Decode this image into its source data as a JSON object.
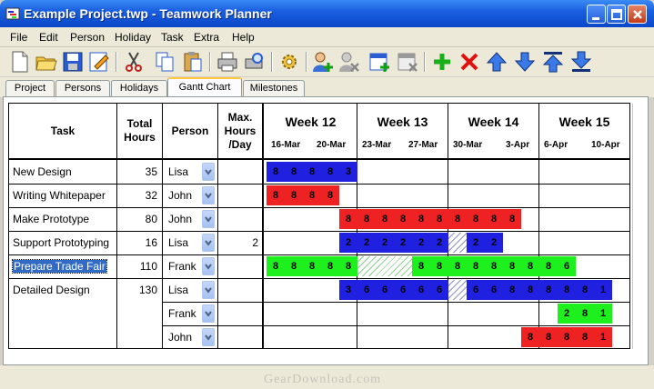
{
  "window": {
    "title": "Example Project.twp - Teamwork Planner"
  },
  "menu": [
    "File",
    "Edit",
    "Person",
    "Holiday",
    "Task",
    "Extra",
    "Help"
  ],
  "toolbar": {
    "icons": [
      "new-document-icon",
      "open-folder-icon",
      "save-icon",
      "edit-icon",
      "cut-icon",
      "copy-icon",
      "paste-icon",
      "print-icon",
      "print-preview-icon",
      "settings-icon",
      "add-person-icon",
      "remove-person-icon",
      "add-week-icon",
      "remove-week-icon",
      "add-icon",
      "delete-icon",
      "move-up-icon",
      "move-down-icon",
      "move-top-icon",
      "move-bottom-icon"
    ]
  },
  "tabs": [
    {
      "label": "Project",
      "active": false
    },
    {
      "label": "Persons",
      "active": false
    },
    {
      "label": "Holidays",
      "active": false
    },
    {
      "label": "Gantt Chart",
      "active": true
    },
    {
      "label": "Milestones",
      "active": false
    }
  ],
  "table": {
    "headers": {
      "task": "Task",
      "total_hours_1": "Total",
      "total_hours_2": "Hours",
      "person": "Person",
      "max_1": "Max.",
      "max_2": "Hours",
      "max_3": "/Day"
    },
    "weeks": [
      {
        "title": "Week 12",
        "d1": "16-Mar",
        "d2": "20-Mar"
      },
      {
        "title": "Week 13",
        "d1": "23-Mar",
        "d2": "27-Mar"
      },
      {
        "title": "Week 14",
        "d1": "30-Mar",
        "d2": "3-Apr"
      },
      {
        "title": "Week 15",
        "d1": "6-Apr",
        "d2": "10-Apr"
      }
    ],
    "rows": [
      {
        "task": "New Design",
        "hours": "35",
        "person": "Lisa",
        "max": ""
      },
      {
        "task": "Writing Whitepaper",
        "hours": "32",
        "person": "John",
        "max": ""
      },
      {
        "task": "Make Prototype",
        "hours": "80",
        "person": "John",
        "max": ""
      },
      {
        "task": "Support Prototyping",
        "hours": "16",
        "person": "Lisa",
        "max": "2"
      },
      {
        "task": "Prepare Trade Fair",
        "hours": "110",
        "person": "Frank",
        "max": "",
        "selected": true
      },
      {
        "task": "Detailed Design",
        "hours": "130",
        "person": "Lisa",
        "max": ""
      },
      {
        "task": "",
        "hours": "",
        "person": "Frank",
        "max": ""
      },
      {
        "task": "",
        "hours": "",
        "person": "John",
        "max": ""
      }
    ],
    "gantt": [
      {
        "segments": [
          {
            "start": 0,
            "color": "blue",
            "cells": [
              "8",
              "8",
              "8",
              "8",
              "3"
            ]
          }
        ]
      },
      {
        "segments": [
          {
            "start": 0,
            "color": "red",
            "cells": [
              "8",
              "8",
              "8",
              "8"
            ]
          }
        ]
      },
      {
        "segments": [
          {
            "start": 4,
            "color": "red",
            "cells": [
              "8",
              "8",
              "8",
              "8",
              "8",
              "8",
              "8",
              "8",
              "8",
              "8"
            ]
          }
        ]
      },
      {
        "segments": [
          {
            "start": 4,
            "color": "blue",
            "cells": [
              "2",
              "2",
              "2",
              "2",
              "2",
              "2"
            ]
          },
          {
            "start": 10,
            "color": "hatchb",
            "cells": [
              ""
            ]
          },
          {
            "start": 11,
            "color": "blue",
            "cells": [
              "2",
              "2"
            ]
          }
        ]
      },
      {
        "segments": [
          {
            "start": 0,
            "color": "green",
            "cells": [
              "8",
              "8",
              "8",
              "8",
              "8"
            ]
          },
          {
            "start": 5,
            "color": "hatch",
            "cells": [
              "",
              "",
              "",
              ""
            ]
          },
          {
            "start": 8,
            "color": "green",
            "cells": [
              "8",
              "8",
              "8",
              "8",
              "8",
              "8",
              "8",
              "8",
              "6"
            ]
          }
        ]
      },
      {
        "segments": [
          {
            "start": 4,
            "color": "blue",
            "cells": [
              "3",
              "6",
              "6",
              "6",
              "6",
              "6"
            ]
          },
          {
            "start": 10,
            "color": "hatchb",
            "cells": [
              ""
            ]
          },
          {
            "start": 11,
            "color": "blue",
            "cells": [
              "6",
              "6",
              "8",
              "8",
              "8",
              "8",
              "8",
              "1"
            ]
          }
        ]
      },
      {
        "segments": [
          {
            "start": 16,
            "color": "green",
            "cells": [
              "2",
              "8",
              "1"
            ]
          }
        ]
      },
      {
        "segments": [
          {
            "start": 14,
            "color": "red",
            "cells": [
              "8",
              "8",
              "8",
              "8",
              "1"
            ]
          }
        ]
      }
    ]
  },
  "watermark": "GearDownload.com",
  "colors": {
    "blue": "#2020e0",
    "red": "#ee2222",
    "green": "#1ef01e",
    "titlebar": "#0a48c8"
  }
}
